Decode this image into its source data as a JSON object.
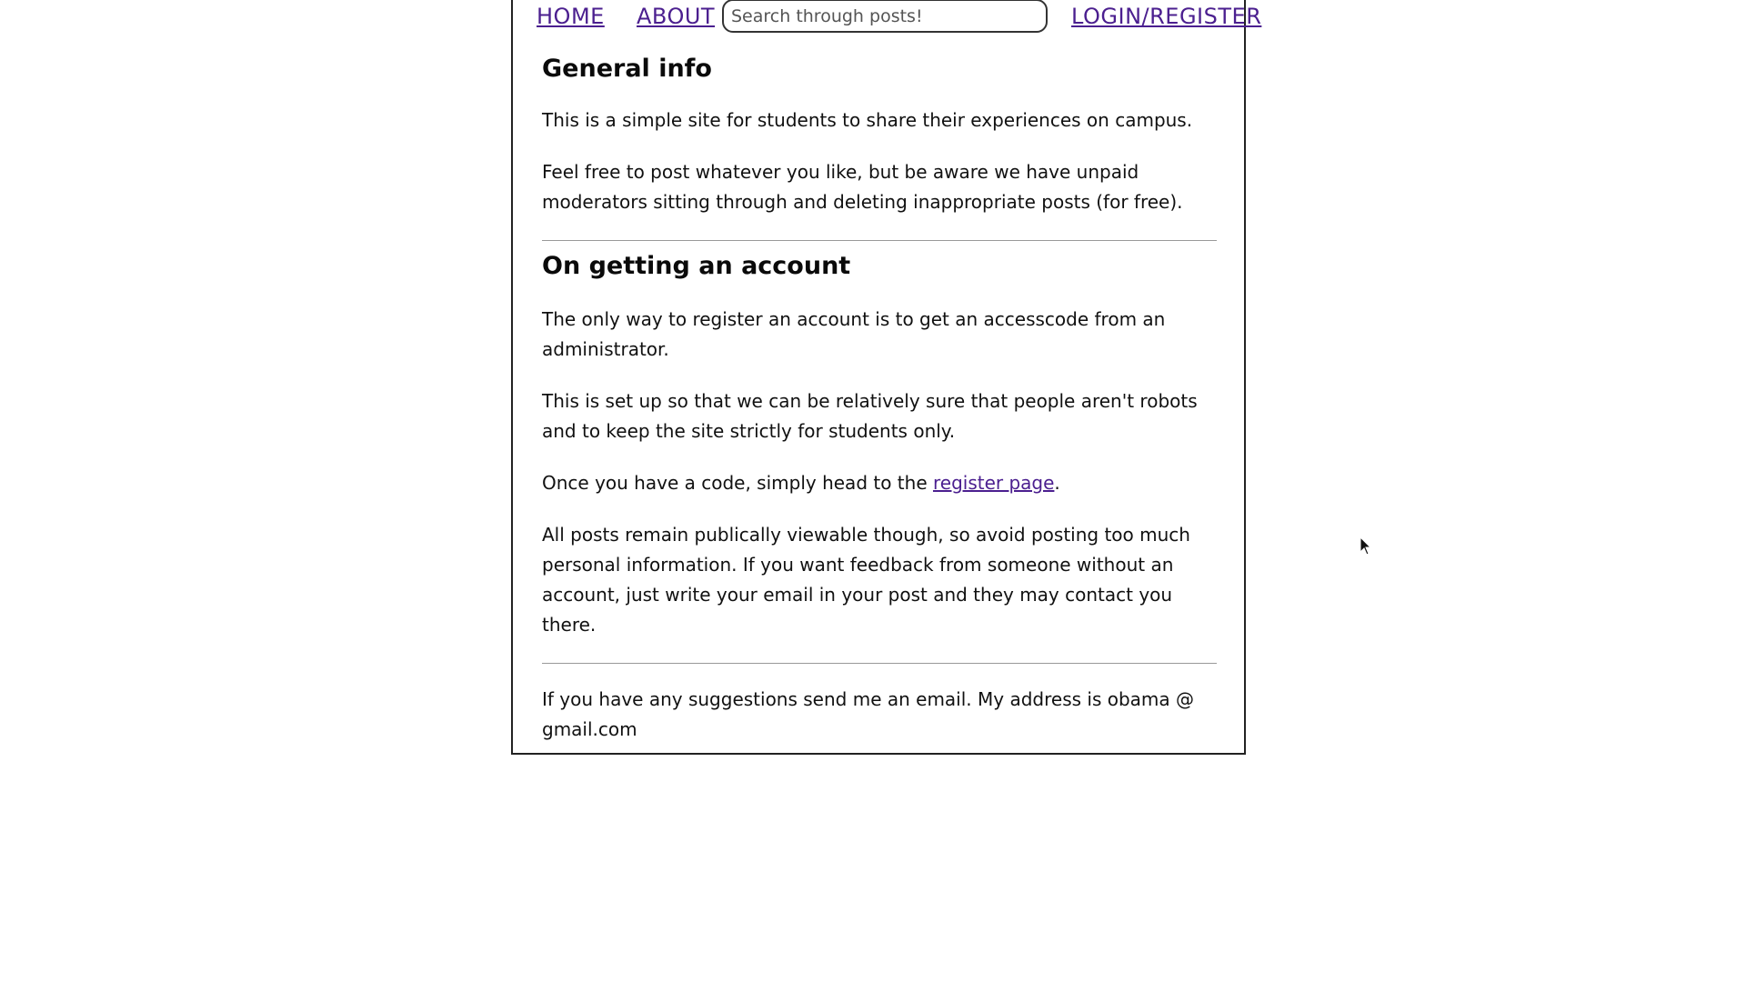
{
  "nav": {
    "home_label": "HOME",
    "about_label": "ABOUT",
    "search_placeholder": "Search through posts!",
    "login_label": "LOGIN/REGISTER"
  },
  "general": {
    "title": "General info",
    "p1": "This is a simple site for students to share their experiences on campus.",
    "p2": "Feel free to post whatever you like, but be aware we have unpaid moderators sitting through and deleting inappropriate posts (for free)."
  },
  "account": {
    "title": "On getting an account",
    "p1": "The only way to register an account is to get an accesscode from an administrator.",
    "p2": "This is set up so that we can be relatively sure that people aren't robots and to keep the site strictly for students only.",
    "p3_before": "Once you have a code, simply head to the ",
    "p3_link": "register page",
    "p3_after": ".",
    "p4": "All posts remain publically viewable though, so avoid posting too much personal information. If you want feedback from someone without an account, just write your email in your post and they may contact you there."
  },
  "footer": {
    "contact": "If you have any suggestions send me an email. My address is obama @ gmail.com"
  },
  "colors": {
    "link": "#4b1f8f",
    "border": "#222222",
    "divider": "#999999"
  },
  "icons": {
    "cursor": "mouse-pointer-icon"
  }
}
